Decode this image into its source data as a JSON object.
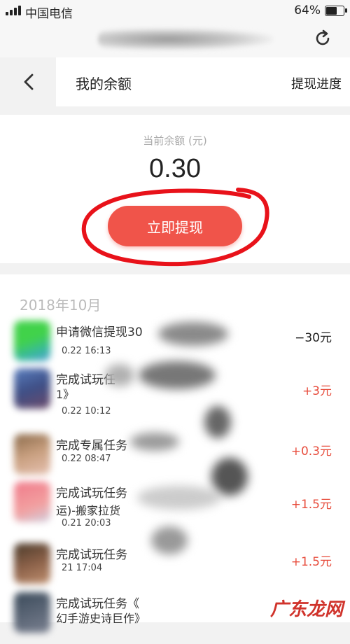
{
  "status_bar": {
    "carrier": "中国电信",
    "battery": "64%",
    "battery_level": 0.64
  },
  "nav": {
    "title": "我的余额",
    "action": "提现进度"
  },
  "balance": {
    "label": "当前余额 (元)",
    "value": "0.30",
    "button": "立即提现"
  },
  "list": {
    "month": "2018年10月",
    "items": [
      {
        "title": "申请微信提现30",
        "subtitle": "",
        "time": "0.22 16:13",
        "amount": "−30元",
        "sign": "neg"
      },
      {
        "title": "完成试玩任",
        "subtitle": "1》",
        "time": "0.22 10:12",
        "amount": "+3元",
        "sign": "pos"
      },
      {
        "title": "完成专属任务",
        "subtitle": "",
        "time": "0.22 08:47",
        "amount": "+0.3元",
        "sign": "pos"
      },
      {
        "title": "完成试玩任务",
        "subtitle": "运)-搬家拉货",
        "time": "0.21 20:03",
        "amount": "+1.5元",
        "sign": "pos"
      },
      {
        "title": "完成试玩任务",
        "subtitle": "",
        "time": "21 17:04",
        "amount": "+1.5元",
        "sign": "pos"
      },
      {
        "title": "完成试玩任务《",
        "subtitle": "幻手游史诗巨作》",
        "time": "",
        "amount": "",
        "sign": "pos"
      }
    ]
  },
  "watermark": "广东龙网",
  "colors": {
    "accent": "#f0544a",
    "positive": "#e74c3c",
    "annotation": "#e8121a"
  }
}
